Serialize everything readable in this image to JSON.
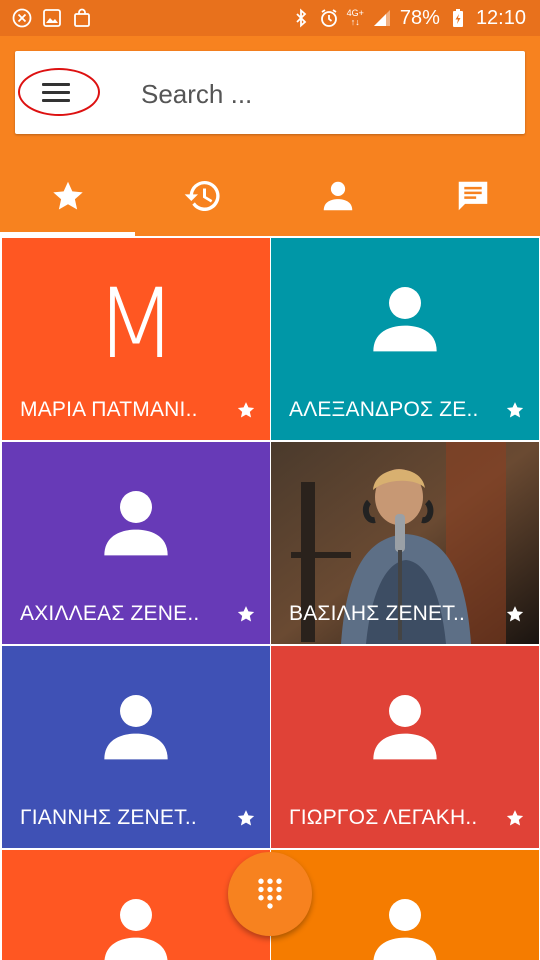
{
  "status_bar": {
    "network": "4G+",
    "battery": "78%",
    "time": "12:10"
  },
  "search": {
    "placeholder": "Search ..."
  },
  "tabs": [
    {
      "icon": "star-icon",
      "selected": true
    },
    {
      "icon": "history-icon",
      "selected": false
    },
    {
      "icon": "person-icon",
      "selected": false
    },
    {
      "icon": "message-icon",
      "selected": false
    }
  ],
  "contacts": [
    {
      "name": "ΜΑΡΙΑ ΠΑΤΜΑΝΙ..",
      "initial": "M",
      "color": "#ff5722"
    },
    {
      "name": "ΑΛΕΞΑΝΔΡΟΣ ΖΕ..",
      "color": "#0097a7"
    },
    {
      "name": "ΑΧΙΛΛΕΑΣ ΖΕΝΕ..",
      "color": "#673ab7"
    },
    {
      "name": "ΒΑΣΙΛΗΣ ΖΕΝΕΤ..",
      "color": "#3a2a20",
      "photo": true
    },
    {
      "name": "ΓΙΑΝΝΗΣ ΖΕΝΕΤ..",
      "color": "#3f51b5"
    },
    {
      "name": "ΓΙΩΡΓΟΣ ΛΕΓΑΚΗ..",
      "color": "#e04237"
    },
    {
      "name": "",
      "color": "#ff5722"
    },
    {
      "name": "",
      "color": "#f57c00"
    }
  ]
}
